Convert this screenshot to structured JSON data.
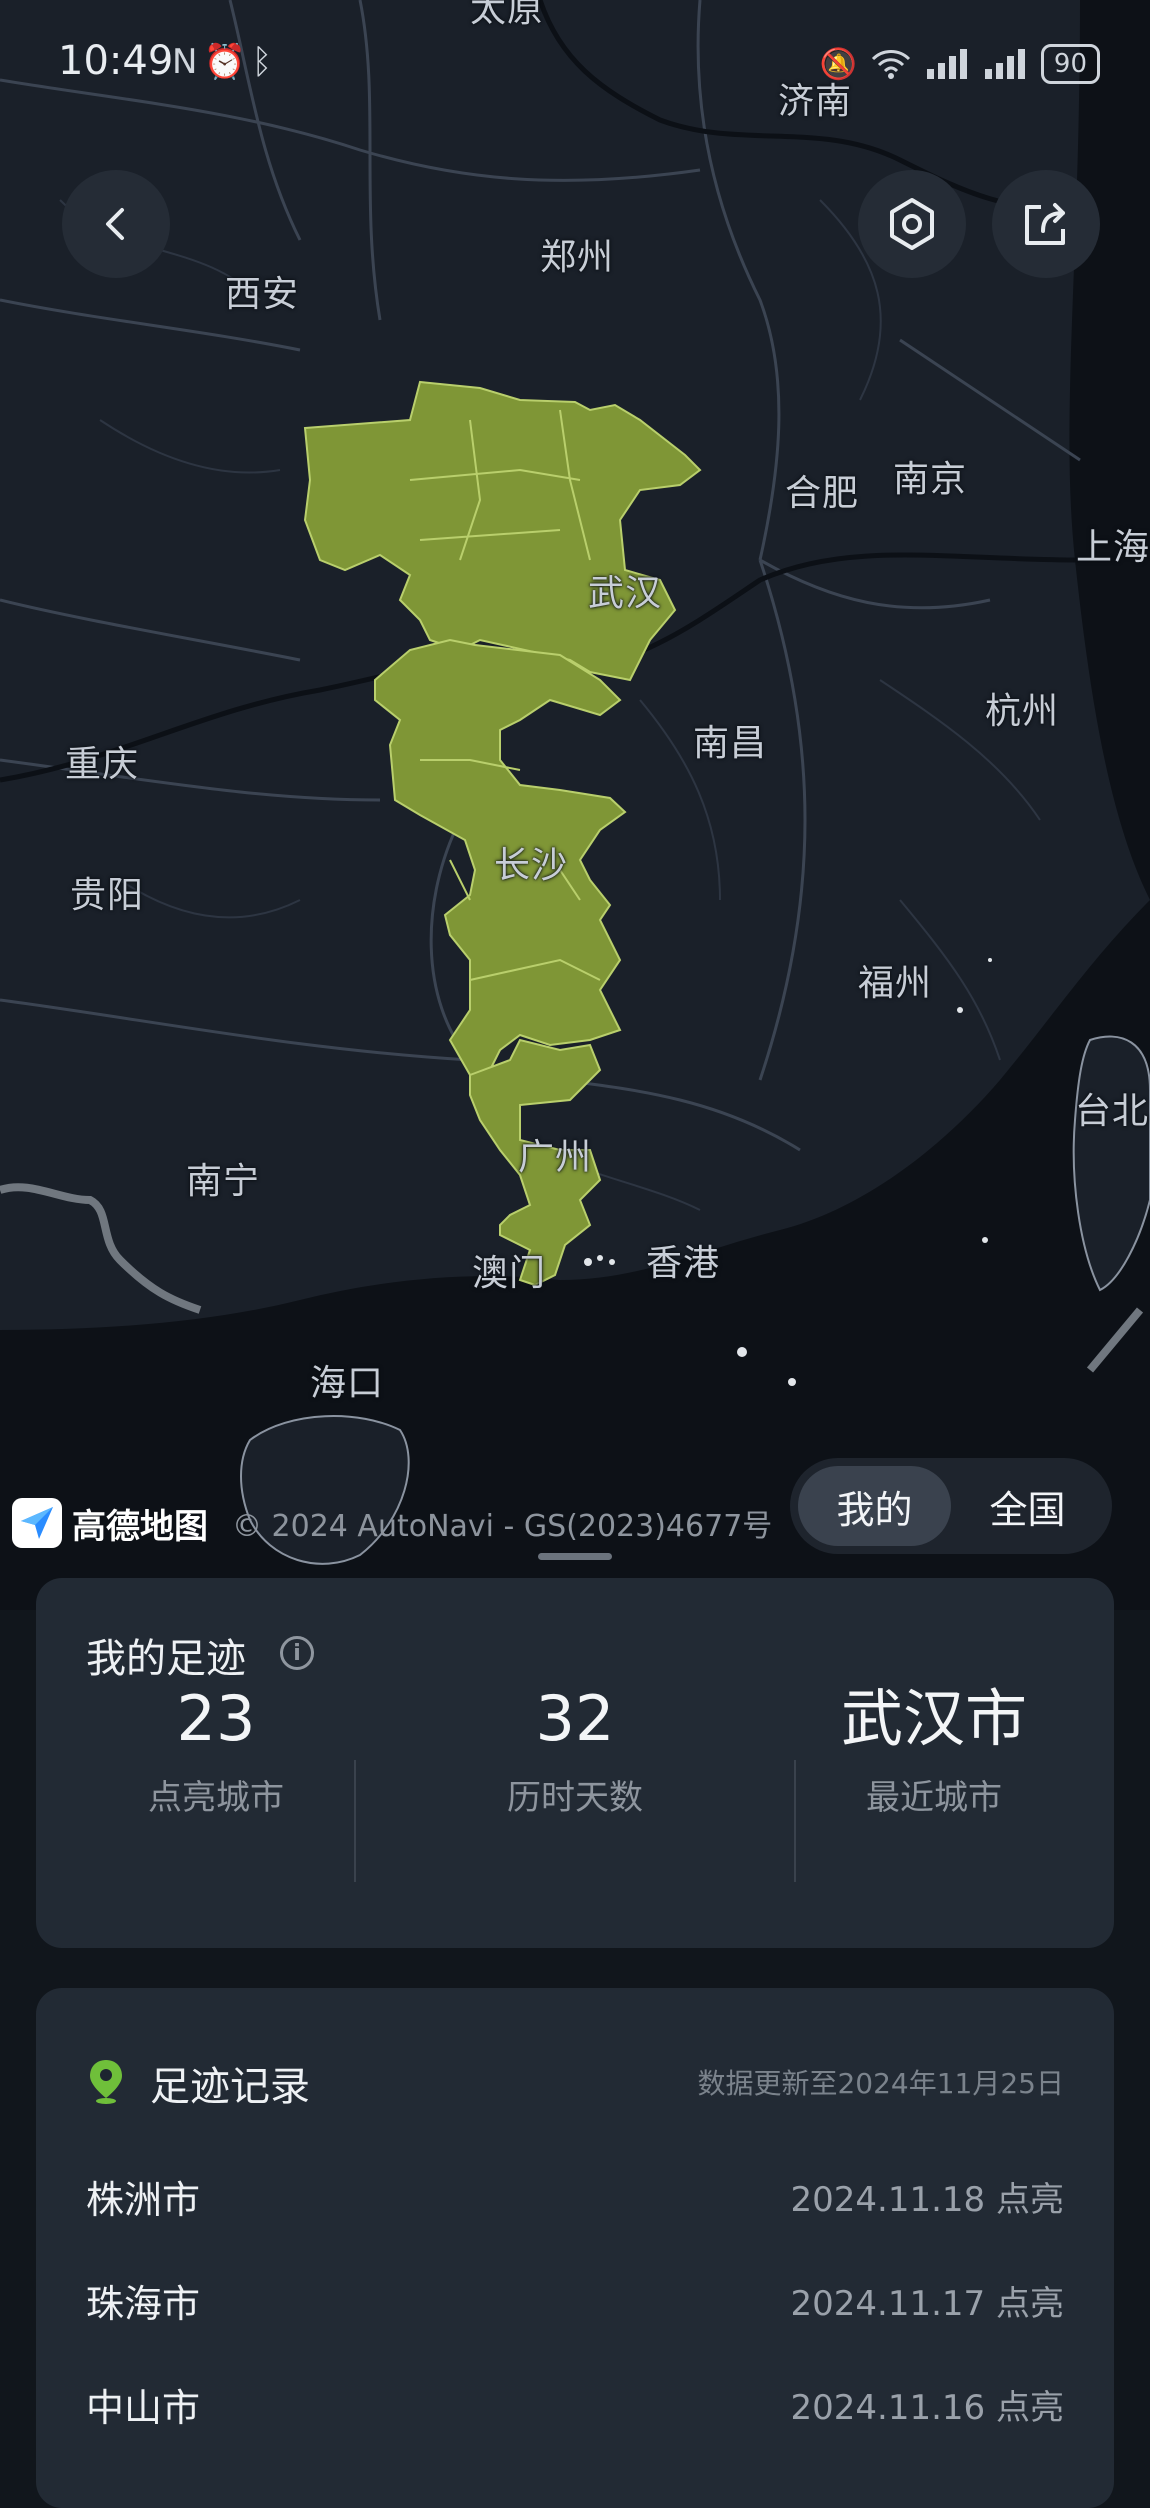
{
  "status_bar": {
    "time": "10:49",
    "left_icons": [
      "nfc-icon",
      "alarm-icon",
      "bluetooth-icon"
    ],
    "right_icons": [
      "mute-icon",
      "wifi-icon",
      "signal-icon",
      "signal-icon"
    ],
    "battery": "90"
  },
  "map": {
    "cities": [
      {
        "name": "济南"
      },
      {
        "name": "郑州"
      },
      {
        "name": "西安"
      },
      {
        "name": "合肥"
      },
      {
        "name": "南京"
      },
      {
        "name": "上海"
      },
      {
        "name": "武汉"
      },
      {
        "name": "杭州"
      },
      {
        "name": "重庆"
      },
      {
        "name": "南昌"
      },
      {
        "name": "长沙"
      },
      {
        "name": "贵阳"
      },
      {
        "name": "福州"
      },
      {
        "name": "台北"
      },
      {
        "name": "南宁"
      },
      {
        "name": "广州"
      },
      {
        "name": "澳门"
      },
      {
        "name": "香港"
      },
      {
        "name": "海口"
      },
      {
        "name": "太原"
      }
    ],
    "visited_color": "#7f9636",
    "provider_name": "高德地图",
    "copyright": "© 2024 AutoNavi - GS(2023)4677号"
  },
  "buttons": {
    "back": "back-icon",
    "settings": "settings-icon",
    "share": "share-icon"
  },
  "scope_toggle": {
    "mine": "我的",
    "all": "全国",
    "selected": "我的"
  },
  "summary": {
    "title": "我的足迹",
    "stats": [
      {
        "value": "23",
        "label": "点亮城市"
      },
      {
        "value": "32",
        "label": "历时天数"
      },
      {
        "value": "武汉市",
        "label": "最近城市"
      }
    ]
  },
  "records": {
    "title": "足迹记录",
    "updated_note": "数据更新至2024年11月25日",
    "items": [
      {
        "city": "株洲市",
        "date": "2024.11.18 点亮"
      },
      {
        "city": "珠海市",
        "date": "2024.11.17 点亮"
      },
      {
        "city": "中山市",
        "date": "2024.11.16 点亮"
      }
    ]
  }
}
